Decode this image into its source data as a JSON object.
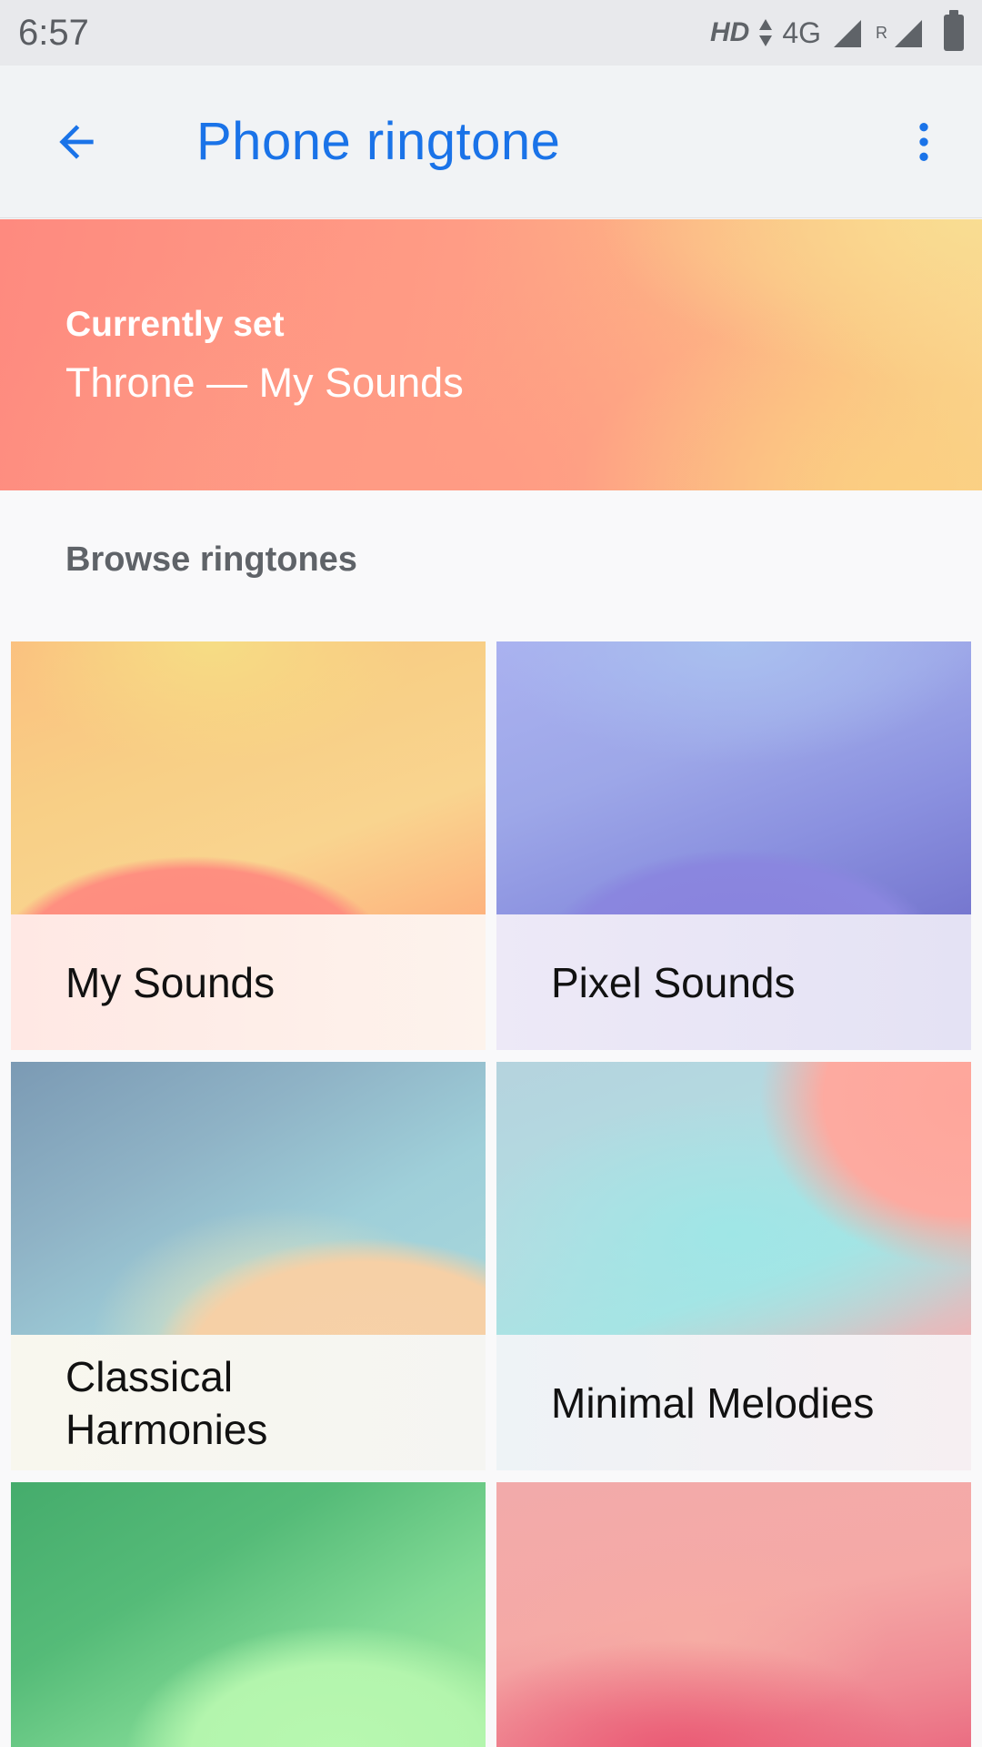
{
  "status_bar": {
    "time": "6:57",
    "hd": "HD",
    "network": "4G",
    "roaming": "R"
  },
  "app_bar": {
    "title": "Phone ringtone",
    "back_icon": "arrow-back-icon",
    "menu_icon": "more-vert-icon",
    "accent_color": "#1a73e8"
  },
  "current": {
    "label": "Currently set",
    "value": "Throne — My Sounds"
  },
  "browse": {
    "title": "Browse ringtones",
    "categories": [
      {
        "label": "My Sounds"
      },
      {
        "label": "Pixel Sounds"
      },
      {
        "label": "Classical Harmonies"
      },
      {
        "label": "Minimal Melodies"
      },
      {
        "label": ""
      },
      {
        "label": ""
      }
    ]
  }
}
